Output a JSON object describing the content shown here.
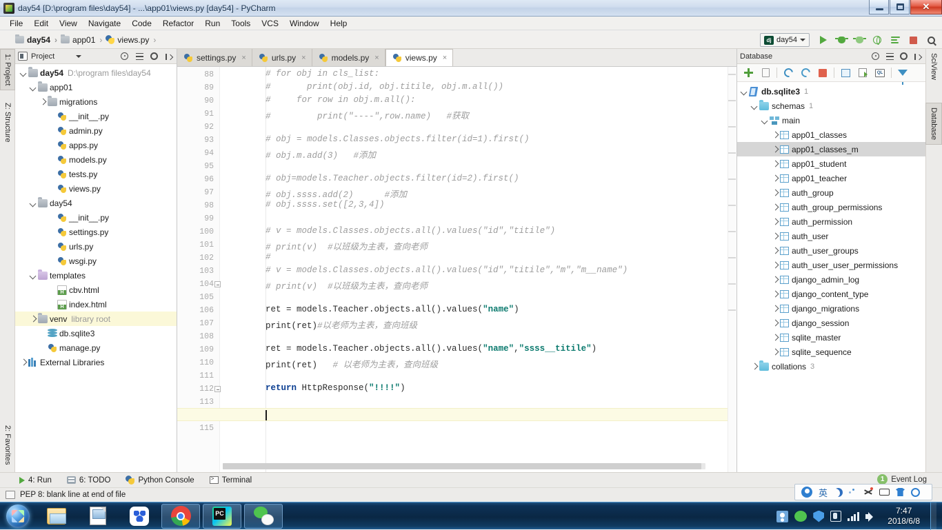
{
  "window": {
    "title": "day54 [D:\\program files\\day54] - ...\\app01\\views.py [day54] - PyCharm",
    "app_icon": "pycharm-icon",
    "controls": {
      "minimize": "minimize-icon",
      "maximize": "maximize-icon",
      "close": "close-icon"
    }
  },
  "menubar": {
    "items": [
      {
        "label": "File"
      },
      {
        "label": "Edit"
      },
      {
        "label": "View"
      },
      {
        "label": "Navigate"
      },
      {
        "label": "Code"
      },
      {
        "label": "Refactor"
      },
      {
        "label": "Run"
      },
      {
        "label": "Tools"
      },
      {
        "label": "VCS"
      },
      {
        "label": "Window"
      },
      {
        "label": "Help"
      }
    ]
  },
  "navbar": {
    "breadcrumbs": [
      {
        "label": "day54",
        "icon": "folder-icon",
        "bold": true
      },
      {
        "label": "app01",
        "icon": "folder-icon",
        "bold": false
      },
      {
        "label": "views.py",
        "icon": "python-file-icon",
        "bold": false
      }
    ],
    "separator": "›",
    "run_config": {
      "label": "day54",
      "badge": "dj"
    },
    "buttons": [
      {
        "name": "run-button",
        "icon": "run-triangle-icon"
      },
      {
        "name": "debug-button",
        "icon": "bug-icon"
      },
      {
        "name": "coverage-button",
        "icon": "coverage-icon"
      },
      {
        "name": "profile-button",
        "icon": "globe-run-icon"
      },
      {
        "name": "attach-button",
        "icon": "lines-arrow-icon"
      },
      {
        "name": "stop-button",
        "icon": "stop-square-icon"
      },
      {
        "name": "search-everywhere-button",
        "icon": "magnifier-icon"
      }
    ]
  },
  "left_tool_tabs": [
    {
      "label": "1: Project",
      "selected": true
    },
    {
      "label": "Z: Structure",
      "selected": false
    },
    {
      "label": "2: Favorites",
      "selected": false
    }
  ],
  "right_tool_tabs": [
    {
      "label": "SciView",
      "selected": false
    },
    {
      "label": "Database",
      "selected": true
    }
  ],
  "project_panel": {
    "title": "Project",
    "header_icons": [
      "project-view-icon",
      "chevron-down-icon",
      "locate-icon",
      "collapse-all-icon",
      "settings-gear-icon",
      "hide-panel-icon"
    ],
    "tree": [
      {
        "depth": 0,
        "arrow": "down",
        "icon": "folder-icon",
        "label": "day54",
        "sub": "D:\\program files\\day54",
        "bold": true
      },
      {
        "depth": 1,
        "arrow": "down",
        "icon": "folder-icon",
        "label": "app01",
        "sub": ""
      },
      {
        "depth": 2,
        "arrow": "right",
        "icon": "folder-icon",
        "label": "migrations",
        "sub": ""
      },
      {
        "depth": 3,
        "arrow": "none",
        "icon": "python-file-icon",
        "label": "__init__.py",
        "sub": ""
      },
      {
        "depth": 3,
        "arrow": "none",
        "icon": "python-file-icon",
        "label": "admin.py",
        "sub": ""
      },
      {
        "depth": 3,
        "arrow": "none",
        "icon": "python-file-icon",
        "label": "apps.py",
        "sub": ""
      },
      {
        "depth": 3,
        "arrow": "none",
        "icon": "python-file-icon",
        "label": "models.py",
        "sub": ""
      },
      {
        "depth": 3,
        "arrow": "none",
        "icon": "python-file-icon",
        "label": "tests.py",
        "sub": ""
      },
      {
        "depth": 3,
        "arrow": "none",
        "icon": "python-file-icon",
        "label": "views.py",
        "sub": ""
      },
      {
        "depth": 1,
        "arrow": "down",
        "icon": "folder-icon",
        "label": "day54",
        "sub": ""
      },
      {
        "depth": 3,
        "arrow": "none",
        "icon": "python-file-icon",
        "label": "__init__.py",
        "sub": ""
      },
      {
        "depth": 3,
        "arrow": "none",
        "icon": "python-file-icon",
        "label": "settings.py",
        "sub": ""
      },
      {
        "depth": 3,
        "arrow": "none",
        "icon": "python-file-icon",
        "label": "urls.py",
        "sub": ""
      },
      {
        "depth": 3,
        "arrow": "none",
        "icon": "python-file-icon",
        "label": "wsgi.py",
        "sub": ""
      },
      {
        "depth": 1,
        "arrow": "down",
        "icon": "folder-purple-icon",
        "label": "templates",
        "sub": ""
      },
      {
        "depth": 3,
        "arrow": "none",
        "icon": "html-file-icon",
        "label": "cbv.html",
        "sub": ""
      },
      {
        "depth": 3,
        "arrow": "none",
        "icon": "html-file-icon",
        "label": "index.html",
        "sub": ""
      },
      {
        "depth": 1,
        "arrow": "right",
        "icon": "folder-icon",
        "label": "venv",
        "sub": "library root",
        "highlight": true
      },
      {
        "depth": 2,
        "arrow": "none",
        "icon": "sqlite-db-icon",
        "label": "db.sqlite3",
        "sub": ""
      },
      {
        "depth": 2,
        "arrow": "none",
        "icon": "python-file-icon",
        "label": "manage.py",
        "sub": ""
      },
      {
        "depth": 0,
        "arrow": "right",
        "icon": "libraries-icon",
        "label": "External Libraries",
        "sub": ""
      }
    ]
  },
  "editor": {
    "tabs": [
      {
        "label": "settings.py",
        "icon": "python-file-icon",
        "active": false,
        "close": "×"
      },
      {
        "label": "urls.py",
        "icon": "python-file-icon",
        "active": false,
        "close": "×"
      },
      {
        "label": "models.py",
        "icon": "python-file-icon",
        "active": false,
        "close": "×"
      },
      {
        "label": "views.py",
        "icon": "python-file-icon",
        "active": true,
        "close": "×"
      }
    ],
    "first_line_number": 88,
    "current_line": 114,
    "lines": [
      {
        "n": 88,
        "segments": [
          {
            "t": "# for obj in cls_list:",
            "c": "cm"
          }
        ]
      },
      {
        "n": 89,
        "segments": [
          {
            "t": "#       print(obj.id, obj.titile, obj.m.all())",
            "c": "cm"
          }
        ]
      },
      {
        "n": 90,
        "segments": [
          {
            "t": "#     for row in obj.m.all():",
            "c": "cm"
          }
        ]
      },
      {
        "n": 91,
        "segments": [
          {
            "t": "#         print(\"----\",row.name)   #获取",
            "c": "cm"
          }
        ]
      },
      {
        "n": 92,
        "segments": []
      },
      {
        "n": 93,
        "segments": [
          {
            "t": "# obj = models.Classes.objects.filter(id=1).first()",
            "c": "cm"
          }
        ]
      },
      {
        "n": 94,
        "segments": [
          {
            "t": "# obj.m.add(3)   #添加",
            "c": "cm"
          }
        ]
      },
      {
        "n": 95,
        "segments": []
      },
      {
        "n": 96,
        "segments": [
          {
            "t": "# obj=models.Teacher.objects.filter(id=2).first()",
            "c": "cm"
          }
        ]
      },
      {
        "n": 97,
        "segments": [
          {
            "t": "# obj.ssss.add(2)      #添加",
            "c": "cm"
          }
        ]
      },
      {
        "n": 98,
        "segments": [
          {
            "t": "# obj.ssss.set([2,3,4])",
            "c": "cm"
          }
        ]
      },
      {
        "n": 99,
        "segments": []
      },
      {
        "n": 100,
        "segments": [
          {
            "t": "# v = models.Classes.objects.all().values(\"id\",\"titile\")",
            "c": "cm"
          }
        ]
      },
      {
        "n": 101,
        "segments": [
          {
            "t": "# print(v)  #以班级为主表，查向老师",
            "c": "cm"
          }
        ]
      },
      {
        "n": 102,
        "segments": [
          {
            "t": "#",
            "c": "cm"
          }
        ]
      },
      {
        "n": 103,
        "segments": [
          {
            "t": "# v = models.Classes.objects.all().values(\"id\",\"titile\",\"m\",\"m__name\")",
            "c": "cm"
          }
        ]
      },
      {
        "n": 104,
        "segments": [
          {
            "t": "# print(v)  #以班级为主表，查向老师",
            "c": "cm"
          }
        ],
        "fold": true
      },
      {
        "n": 105,
        "segments": []
      },
      {
        "n": 106,
        "segments": [
          {
            "t": "ret = models.Teacher.objects.all().values(",
            "c": "pl"
          },
          {
            "t": "\"name\"",
            "c": "st"
          },
          {
            "t": ")",
            "c": "pl"
          }
        ]
      },
      {
        "n": 107,
        "segments": [
          {
            "t": "print(ret)",
            "c": "pl"
          },
          {
            "t": "#以老师为主表，查向班级",
            "c": "cm"
          }
        ]
      },
      {
        "n": 108,
        "segments": []
      },
      {
        "n": 109,
        "segments": [
          {
            "t": "ret = models.Teacher.objects.all().values(",
            "c": "pl"
          },
          {
            "t": "\"name\"",
            "c": "st"
          },
          {
            "t": ",",
            "c": "pl"
          },
          {
            "t": "\"ssss__titile\"",
            "c": "st"
          },
          {
            "t": ")",
            "c": "pl"
          }
        ]
      },
      {
        "n": 110,
        "segments": [
          {
            "t": "print(ret)   ",
            "c": "pl"
          },
          {
            "t": "# 以老师为主表，查向班级",
            "c": "cm"
          }
        ]
      },
      {
        "n": 111,
        "segments": []
      },
      {
        "n": 112,
        "segments": [
          {
            "t": "return ",
            "c": "kw"
          },
          {
            "t": "HttpResponse(",
            "c": "pl"
          },
          {
            "t": "\"!!!!\"",
            "c": "st"
          },
          {
            "t": ")",
            "c": "pl"
          }
        ],
        "fold": true
      },
      {
        "n": 113,
        "segments": []
      },
      {
        "n": 114,
        "segments": []
      },
      {
        "n": 115,
        "segments": []
      }
    ]
  },
  "database_panel": {
    "title": "Database",
    "header_icons": [
      "locate-icon",
      "collapse-all-icon",
      "settings-gear-icon",
      "hide-panel-icon"
    ],
    "toolbar": [
      {
        "name": "add-button",
        "icon": "plus-icon"
      },
      {
        "name": "duplicate-button",
        "icon": "copy-icon"
      },
      {
        "name": "refresh-button",
        "icon": "sync-icon"
      },
      {
        "name": "sync-schema-button",
        "icon": "db-sync-icon"
      },
      {
        "name": "stop-button",
        "icon": "stop-square-icon"
      },
      {
        "name": "open-table-button",
        "icon": "table-grid-icon"
      },
      {
        "name": "edit-data-button",
        "icon": "table-edit-icon"
      },
      {
        "name": "sql-console-button",
        "icon": "sql-console-icon"
      },
      {
        "name": "filter-button",
        "icon": "funnel-icon"
      }
    ],
    "tree": [
      {
        "depth": 0,
        "arrow": "down",
        "icon": "sqlite-file-icon",
        "label": "db.sqlite3",
        "count": "1",
        "bold": true
      },
      {
        "depth": 1,
        "arrow": "down",
        "icon": "folder-cyan-icon",
        "label": "schemas",
        "count": "1"
      },
      {
        "depth": 2,
        "arrow": "down",
        "icon": "schema-icon",
        "label": "main",
        "count": ""
      },
      {
        "depth": 3,
        "arrow": "right",
        "icon": "table-icon",
        "label": "app01_classes",
        "count": ""
      },
      {
        "depth": 3,
        "arrow": "right",
        "icon": "table-icon",
        "label": "app01_classes_m",
        "count": "",
        "selected": true
      },
      {
        "depth": 3,
        "arrow": "right",
        "icon": "table-icon",
        "label": "app01_student",
        "count": ""
      },
      {
        "depth": 3,
        "arrow": "right",
        "icon": "table-icon",
        "label": "app01_teacher",
        "count": ""
      },
      {
        "depth": 3,
        "arrow": "right",
        "icon": "table-icon",
        "label": "auth_group",
        "count": ""
      },
      {
        "depth": 3,
        "arrow": "right",
        "icon": "table-icon",
        "label": "auth_group_permissions",
        "count": ""
      },
      {
        "depth": 3,
        "arrow": "right",
        "icon": "table-icon",
        "label": "auth_permission",
        "count": ""
      },
      {
        "depth": 3,
        "arrow": "right",
        "icon": "table-icon",
        "label": "auth_user",
        "count": ""
      },
      {
        "depth": 3,
        "arrow": "right",
        "icon": "table-icon",
        "label": "auth_user_groups",
        "count": ""
      },
      {
        "depth": 3,
        "arrow": "right",
        "icon": "table-icon",
        "label": "auth_user_user_permissions",
        "count": ""
      },
      {
        "depth": 3,
        "arrow": "right",
        "icon": "table-icon",
        "label": "django_admin_log",
        "count": ""
      },
      {
        "depth": 3,
        "arrow": "right",
        "icon": "table-icon",
        "label": "django_content_type",
        "count": ""
      },
      {
        "depth": 3,
        "arrow": "right",
        "icon": "table-icon",
        "label": "django_migrations",
        "count": ""
      },
      {
        "depth": 3,
        "arrow": "right",
        "icon": "table-icon",
        "label": "django_session",
        "count": ""
      },
      {
        "depth": 3,
        "arrow": "right",
        "icon": "table-icon",
        "label": "sqlite_master",
        "count": ""
      },
      {
        "depth": 3,
        "arrow": "right",
        "icon": "table-icon",
        "label": "sqlite_sequence",
        "count": ""
      },
      {
        "depth": 1,
        "arrow": "right",
        "icon": "folder-cyan-icon",
        "label": "collations",
        "count": "3"
      }
    ]
  },
  "bottom_bar": {
    "buttons": [
      {
        "label": "4: Run",
        "icon": "run-triangle-icon"
      },
      {
        "label": "6: TODO",
        "icon": "todo-icon"
      },
      {
        "label": "Python Console",
        "icon": "python-console-icon"
      },
      {
        "label": "Terminal",
        "icon": "terminal-icon"
      }
    ]
  },
  "status_bar": {
    "icon": "inspection-icon",
    "message": "PEP 8: blank line at end of file"
  },
  "event_log": {
    "label": "Event Log",
    "badge": "1"
  },
  "ime_bar": {
    "icons": [
      "sogou-logo-icon",
      "chinese-mode-icon",
      "moon-icon",
      "dots-icon",
      "scissors-icon",
      "keyboard-icon",
      "skin-icon",
      "settings-gear-icon"
    ],
    "mode_label": "英"
  },
  "taskbar": {
    "start": "windows-start-orb",
    "items": [
      {
        "name": "taskbar-explorer",
        "icon": "explorer-icon",
        "running": false
      },
      {
        "name": "taskbar-notepad",
        "icon": "document-icon",
        "running": false
      },
      {
        "name": "taskbar-baidu-netdisk",
        "icon": "baidu-netdisk-icon",
        "running": false
      },
      {
        "name": "taskbar-chrome",
        "icon": "chrome-icon",
        "running": true
      },
      {
        "name": "taskbar-pycharm",
        "icon": "pycharm-icon",
        "running": true
      },
      {
        "name": "taskbar-wechat",
        "icon": "wechat-icon",
        "running": true
      }
    ],
    "tray": [
      "user-icon",
      "wechat-tray-icon",
      "security-shield-icon",
      "tencent-icon",
      "network-icon",
      "volume-icon"
    ],
    "clock": {
      "time": "7:47",
      "date": "2018/6/8"
    }
  },
  "colors": {
    "accent": "#53a93f",
    "string_literal": "#0b7a6e",
    "keyword": "#0a3d91",
    "comment": "#9d9d9d",
    "current_line": "#fcfbe4",
    "taskbar": "#0a2744"
  }
}
